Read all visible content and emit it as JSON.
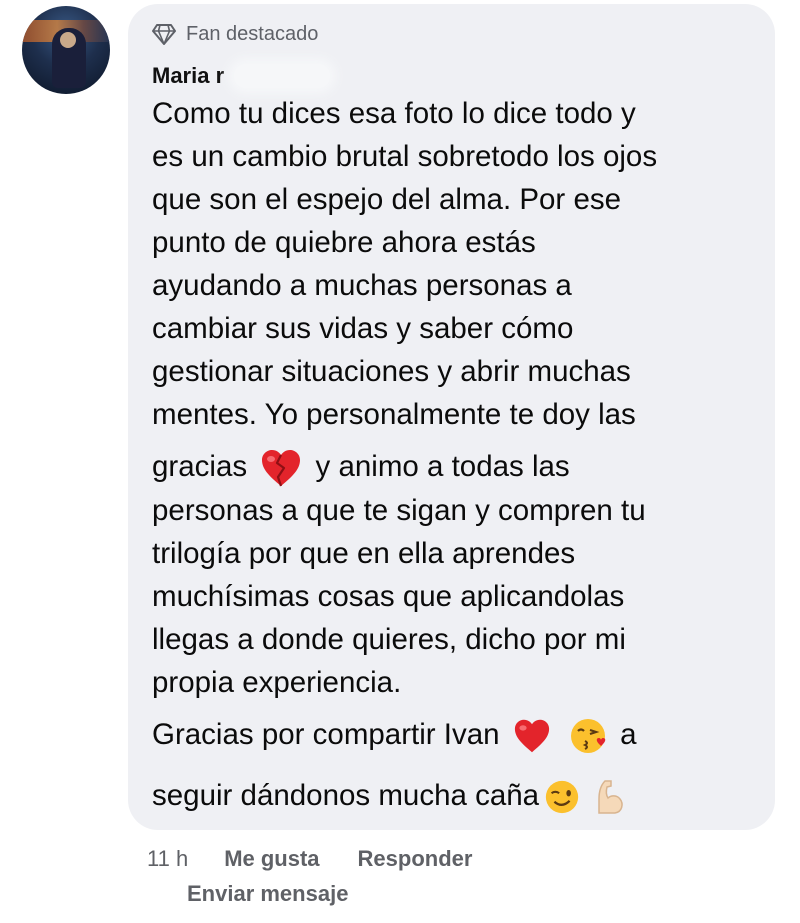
{
  "comment": {
    "badge_label": "Fan destacado",
    "author": "Maria r",
    "lines": [
      "Como tu dices esa foto lo dice todo y",
      "es un cambio brutal sobretodo los ojos",
      "que son el espejo del alma. Por ese",
      "punto de quiebre ahora estás",
      "ayudando a muchas personas a",
      "cambiar sus vidas y saber cómo",
      "gestionar situaciones y abrir muchas",
      "mentes. Yo personalmente te doy las",
      "gracias",
      "y animo a todas las",
      "personas a que te sigan y compren tu",
      "trilogía por que en ella aprendes",
      "muchísimas cosas que aplicandolas",
      "llegas a donde quieres, dicho por mi",
      "propia experiencia.",
      "Gracias por compartir Ivan",
      "a",
      "seguir dándonos mucha caña"
    ],
    "emojis": [
      "broken-heart-emoji",
      "red-heart-emoji",
      "kissing-face-emoji",
      "winking-face-emoji",
      "flexed-biceps-emoji"
    ]
  },
  "actions": {
    "time": "11 h",
    "like": "Me gusta",
    "reply": "Responder",
    "message": "Enviar mensaje"
  },
  "colors": {
    "bubble": "#eff0f4",
    "meta_text": "#5f6166",
    "heart": "#e3242b"
  }
}
